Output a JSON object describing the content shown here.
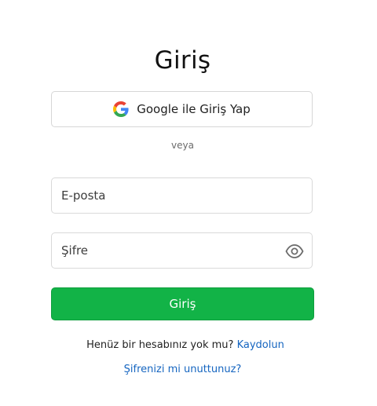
{
  "page": {
    "title": "Giriş"
  },
  "google_button": {
    "label": "Google ile Giriş Yap",
    "icon": "google-icon"
  },
  "divider_text": "veya",
  "email": {
    "placeholder": "E-posta",
    "value": ""
  },
  "password": {
    "placeholder": "Şifre",
    "value": "",
    "toggle_icon": "eye-icon"
  },
  "login_button": {
    "label": "Giriş"
  },
  "signup": {
    "prompt": "Henüz bir hesabınız yok mu?",
    "link_label": "Kaydolun"
  },
  "forgot_password": {
    "label": "Şifrenizi mi unuttunuz?"
  },
  "colors": {
    "primary_button": "#12b347",
    "link": "#1565c0"
  }
}
